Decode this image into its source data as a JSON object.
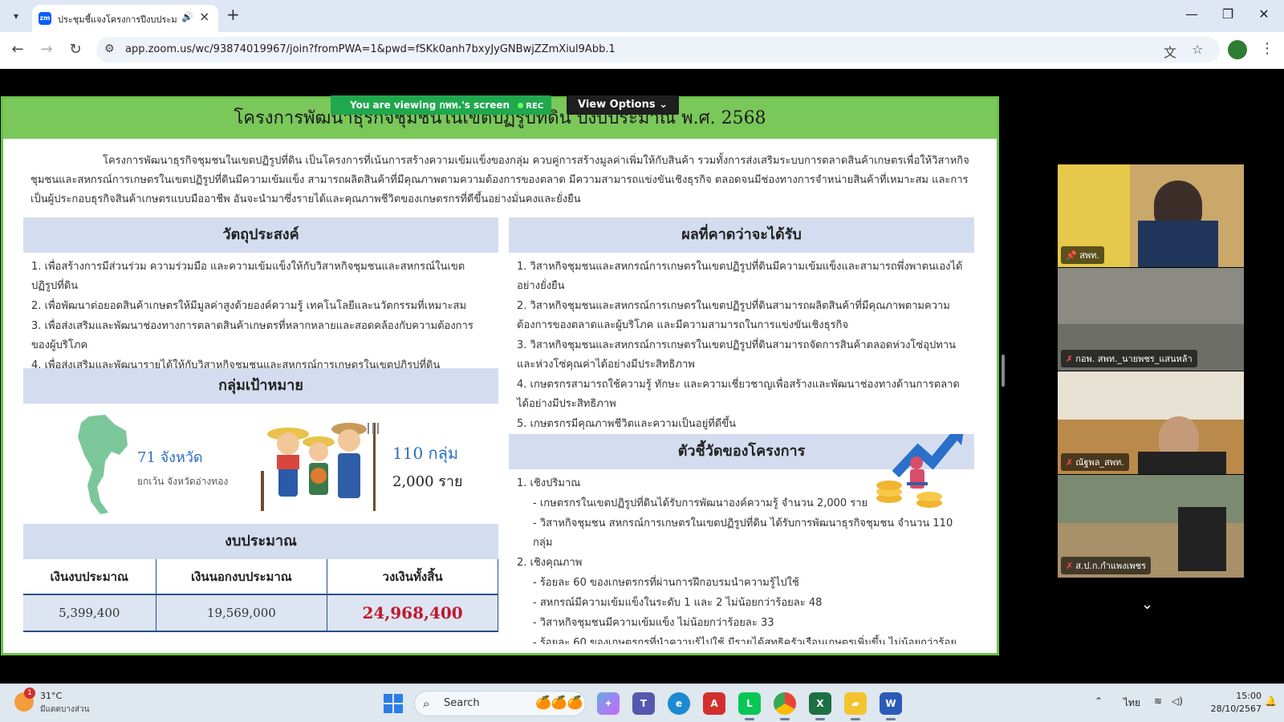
{
  "browser": {
    "tab_title": "ประชุมชี้แจงโครงการปีงบประมาณ",
    "url": "app.zoom.us/wc/93874019967/join?fromPWA=1&pwd=fSKk0anh7bxyJyGNBwjZZmXiul9Abb.1"
  },
  "zoom": {
    "share_text": "You are viewing กพท.'s screen",
    "rec_label": "REC",
    "view_options": "View Options"
  },
  "slide": {
    "title": "โครงการพัฒนาธุรกิจชุมชนในเขตปฏิรูปที่ดิน ปีงบประมาณ พ.ศ. 2568",
    "intro": "โครงการพัฒนาธุรกิจชุมชนในเขตปฏิรูปที่ดิน เป็นโครงการที่เน้นการสร้างความเข้มแข็งของกลุ่ม ควบคู่การสร้างมูลค่าเพิ่มให้กับสินค้า รวมทั้งการส่งเสริมระบบการตลาดสินค้าเกษตรเพื่อให้วิสาหกิจชุมชนและสหกรณ์การเกษตรในเขตปฏิรูปที่ดินมีความเข้มแข็ง สามารถผลิตสินค้าที่มีคุณภาพตามความต้องการของตลาด มีความสามารถแข่งขันเชิงธุรกิจ ตลอดจนมีช่องทางการจำหน่ายสินค้าที่เหมาะสม และการเป็นผู้ประกอบธุรกิจสินค้าเกษตรแบบมืออาชีพ อันจะนำมาซึ่งรายได้และคุณภาพชีวิตของเกษตรกรที่ดีขึ้นอย่างมั่นคงและยั่งยืน",
    "objectives": {
      "heading": "วัตถุประสงค์",
      "items": [
        "1.  เพื่อสร้างการมีส่วนร่วม ความร่วมมือ และความเข้มแข็งให้กับวิสาหกิจชุมชนและสหกรณ์ในเขตปฏิรูปที่ดิน",
        "2.  เพื่อพัฒนาต่อยอดสินค้าเกษตรให้มีมูลค่าสูงด้วยองค์ความรู้ เทคโนโลยีและนวัตกรรมที่เหมาะสม",
        "3.  เพื่อส่งเสริมและพัฒนาช่องทางการตลาดสินค้าเกษตรที่หลากหลายและสอดคล้องกับความต้องการของผู้บริโภค",
        "4.  เพื่อส่งเสริมและพัฒนารายได้ให้กับวิสาหกิจชุมชนและสหกรณ์การเกษตรในเขตปฏิรูปที่ดิน"
      ]
    },
    "target": {
      "heading": "กลุ่มเป้าหมาย",
      "provinces": "71 จังหวัด",
      "provinces_note": "ยกเว้น จังหวัดอ่างทอง",
      "groups": "110 กลุ่ม",
      "people": "2,000 ราย"
    },
    "budget": {
      "heading": "งบประมาณ",
      "columns": [
        "เงินงบประมาณ",
        "เงินนอกงบประมาณ",
        "วงเงินทั้งสิ้น"
      ],
      "values": [
        "5,399,400",
        "19,569,000",
        "24,968,400"
      ]
    },
    "results": {
      "heading": "ผลที่คาดว่าจะได้รับ",
      "items": [
        "1.  วิสาหกิจชุมชนและสหกรณ์การเกษตรในเขตปฏิรูปที่ดินมีความเข้มแข็งและสามารถพึ่งพาตนเองได้อย่างยั่งยืน",
        "2. วิสาหกิจชุมชนและสหกรณ์การเกษตรในเขตปฏิรูปที่ดินสามารถผลิตสินค้าที่มีคุณภาพตามความต้องการของตลาดและผู้บริโภค และมีความสามารถในการแข่งขันเชิงธุรกิจ",
        "3. วิสาหกิจชุมชนและสหกรณ์การเกษตรในเขตปฏิรูปที่ดินสามารถจัดการสินค้าตลอดห่วงโซ่อุปทานและห่วงโซ่คุณค่าได้อย่างมีประสิทธิภาพ",
        "4. เกษตรกรสามารถใช้ความรู้ ทักษะ และความเชี่ยวชาญเพื่อสร้างและพัฒนาช่องทางด้านการตลาดได้อย่างมีประสิทธิภาพ",
        "5. เกษตรกรมีคุณภาพชีวิตและความเป็นอยู่ที่ดีขึ้น"
      ]
    },
    "indicators": {
      "heading": "ตัวชี้วัดของโครงการ",
      "items": [
        "1.  เชิงปริมาณ",
        "- เกษตรกรในเขตปฏิรูปที่ดินได้รับการพัฒนาองค์ความรู้ จำนวน 2,000 ราย",
        "- วิสาหกิจชุมชน สหกรณ์การเกษตรในเขตปฏิรูปที่ดิน ได้รับการพัฒนาธุรกิจชุมชน จำนวน 110 กลุ่ม",
        "2.  เชิงคุณภาพ",
        "- ร้อยละ 60 ของเกษตรกรที่ผ่านการฝึกอบรมนำความรู้ไปใช้",
        "- สหกรณ์มีความเข้มแข็งในระดับ 1 และ 2 ไม่น้อยกว่าร้อยละ 48",
        "- วิสาหกิจชุมชนมีความเข้มแข็ง ไม่น้อยกว่าร้อยละ 33",
        "- ร้อยละ 60 ของเกษตรกรที่นำความรู้ไปใช้ มีรายได้สุทธิครัวเรือนเกษตรเพิ่มขึ้น ไม่น้อยกว่าร้อย"
      ]
    }
  },
  "participants": [
    {
      "name": "สพท.",
      "muted": false,
      "bg": "#c9a86a"
    },
    {
      "name": "กอพ. สพท._นายพชร_แสนหล้า",
      "muted": true,
      "bg": "#8b8b84"
    },
    {
      "name": "ณัฐพล_สพท.",
      "muted": true,
      "bg": "#b98a4a"
    },
    {
      "name": "ส.ป.ก.กำแพงเพชร",
      "muted": true,
      "bg": "#7d8a72"
    }
  ],
  "taskbar": {
    "weather_temp": "31°C",
    "weather_desc": "มีแดดบางส่วน",
    "weather_badge": "1",
    "search": "Search",
    "lang": "ไทย",
    "time": "15:00",
    "date": "28/10/2567"
  }
}
